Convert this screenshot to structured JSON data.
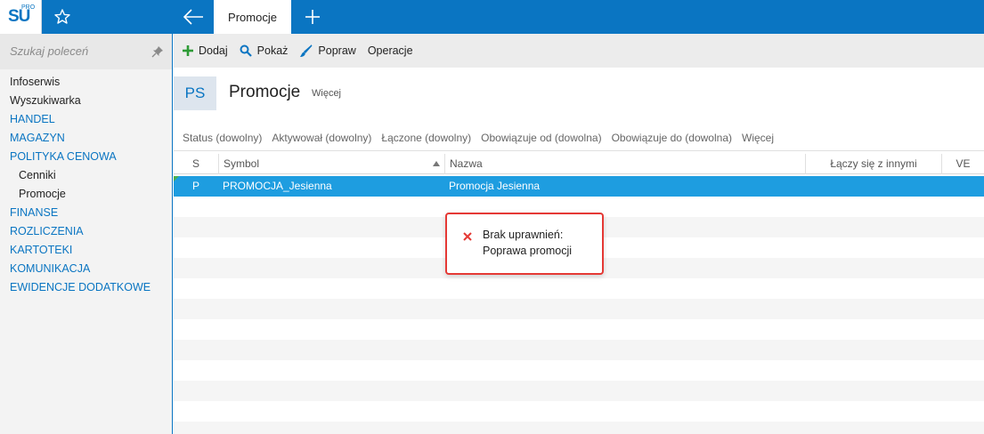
{
  "app": {
    "logo": "SU",
    "logo_sup": "PRO",
    "active_tab": "Promocje"
  },
  "icons": {
    "favorite": "star-icon",
    "back": "arrow-left-icon",
    "new_tab": "plus-icon",
    "pin": "pin-icon",
    "add": "plus-icon",
    "show": "search-icon",
    "edit": "brush-icon",
    "error": "close-icon"
  },
  "colors": {
    "brand": "#0a75c2",
    "selected_row": "#1e9de0",
    "error": "#e53935",
    "add_icon": "#2e9b36"
  },
  "sidebar": {
    "search_placeholder": "Szukaj poleceń",
    "items": [
      {
        "label": "Infoserwis"
      },
      {
        "label": "Wyszukiwarka"
      },
      {
        "label": "HANDEL"
      },
      {
        "label": "MAGAZYN"
      },
      {
        "label": "POLITYKA CENOWA"
      },
      {
        "label": "Cenniki"
      },
      {
        "label": "Promocje"
      },
      {
        "label": "FINANSE"
      },
      {
        "label": "ROZLICZENIA"
      },
      {
        "label": "KARTOTEKI"
      },
      {
        "label": "KOMUNIKACJA"
      },
      {
        "label": "EWIDENCJE DODATKOWE"
      }
    ]
  },
  "toolbar": {
    "add": "Dodaj",
    "show": "Pokaż",
    "edit": "Popraw",
    "operations": "Operacje"
  },
  "header": {
    "badge": "PS",
    "title": "Promocje",
    "more": "Więcej"
  },
  "filters": [
    "Status (dowolny)",
    "Aktywował (dowolny)",
    "Łączone (dowolny)",
    "Obowiązuje od (dowolna)",
    "Obowiązuje do (dowolna)",
    "Więcej"
  ],
  "grid": {
    "columns": [
      "S",
      "Symbol",
      "Nazwa",
      "Łączy się z innymi",
      "VE"
    ],
    "rows": [
      {
        "s": "P",
        "symbol": "PROMOCJA_Jesienna",
        "name": "Promocja Jesienna"
      }
    ]
  },
  "tooltip": {
    "line1": "Brak uprawnień:",
    "line2": "Poprawa promocji"
  }
}
